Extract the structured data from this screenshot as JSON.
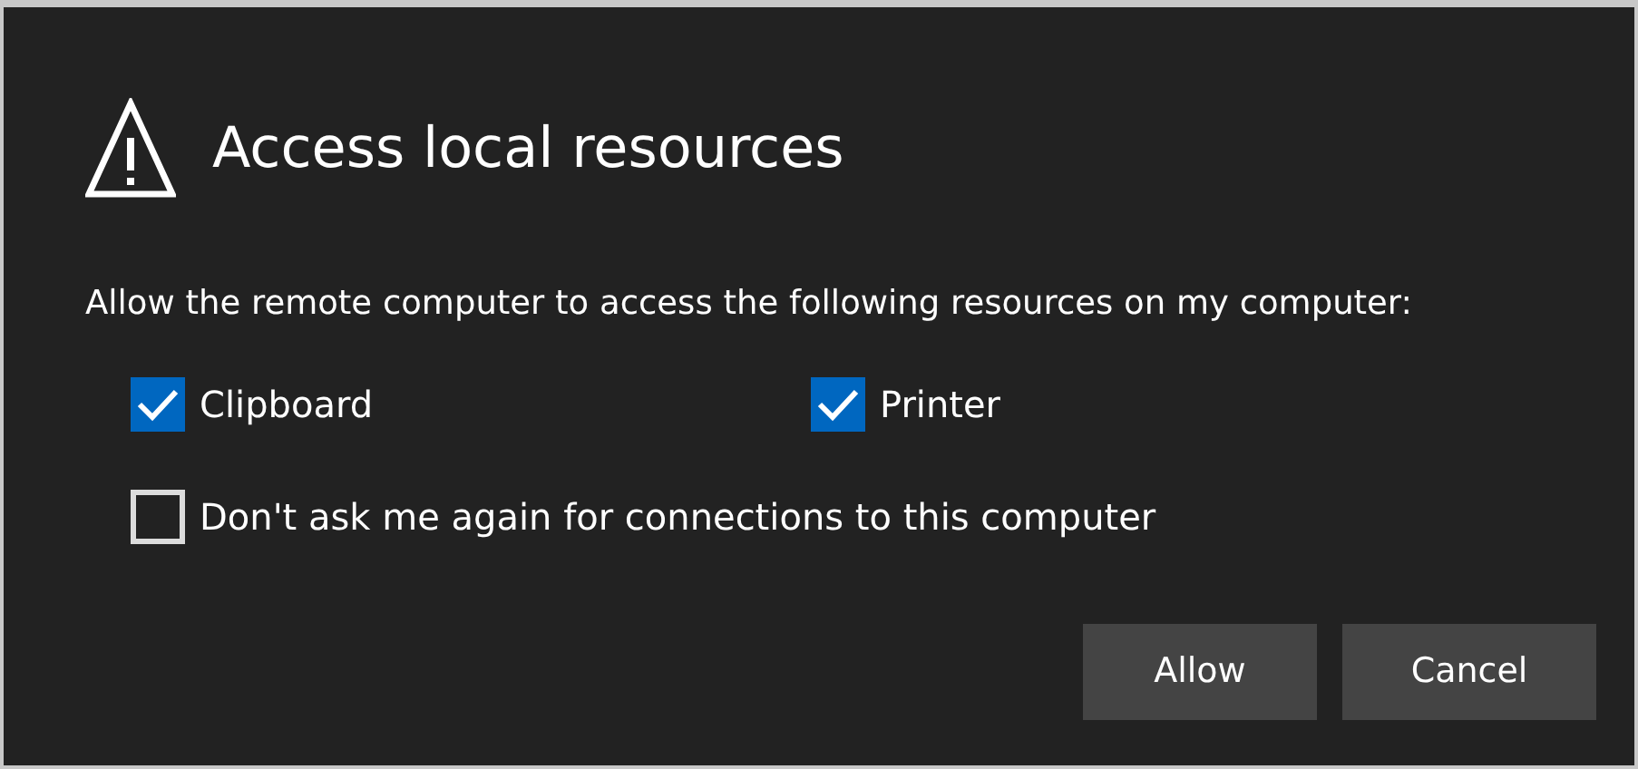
{
  "dialog": {
    "title": "Access local resources",
    "description": "Allow the remote computer to access the following resources on my computer:",
    "resources": [
      {
        "label": "Clipboard",
        "checked": true
      },
      {
        "label": "Printer",
        "checked": true
      }
    ],
    "dont_ask": {
      "label": "Don't ask me again for connections to this computer",
      "checked": false
    },
    "buttons": [
      "Allow",
      "Cancel"
    ]
  }
}
